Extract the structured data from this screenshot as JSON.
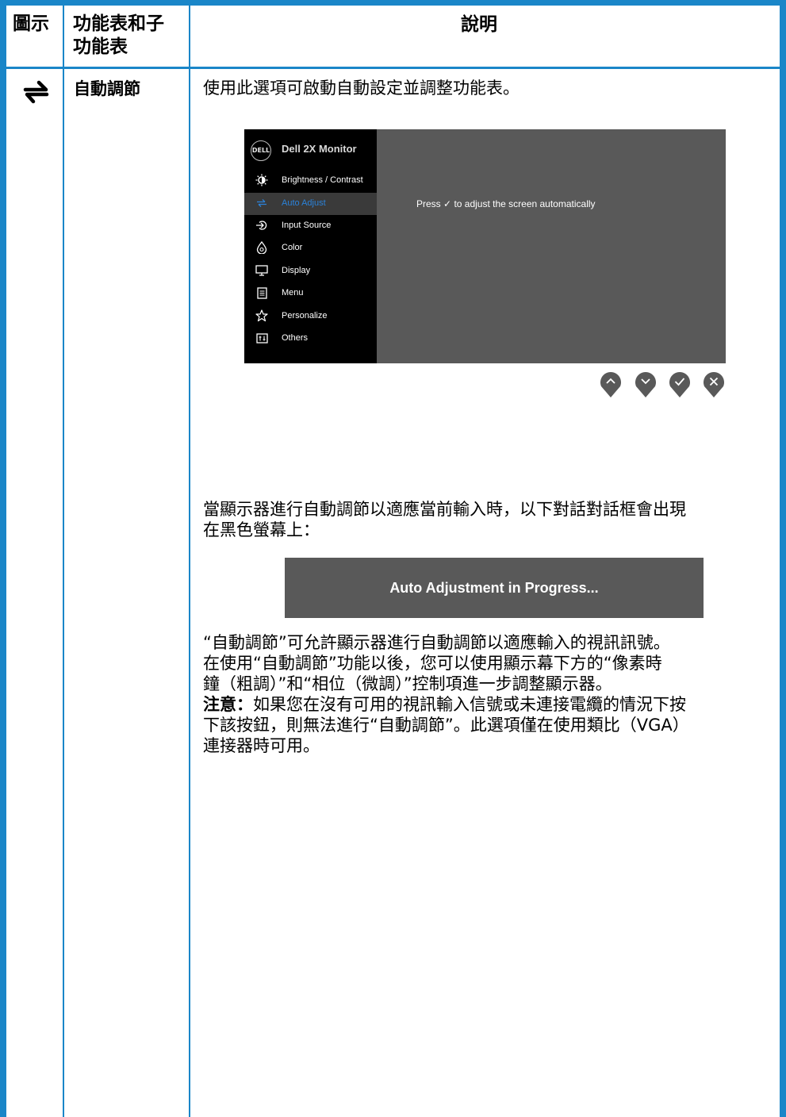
{
  "table": {
    "headers": {
      "icon": "圖示",
      "menu_line1": "功能表和子",
      "menu_line2": "功能表",
      "description": "說明"
    },
    "row": {
      "menu_name": "自動調節",
      "intro": "使用此選項可啟動自動設定並調整功能表。",
      "dialog_intro_line1": "當顯示器進行自動調節以適應當前輸入時，以下對話對話框會出現",
      "dialog_intro_line2": "在黑色螢幕上：",
      "para_line1": "“自動調節”可允許顯示器進行自動調節以適應輸入的視訊訊號。",
      "para_line2": "在使用“自動調節”功能以後，您可以使用顯示幕下方的“像素時",
      "para_line3": "鐘（粗調）”和“相位（微調）”控制項進一步調整顯示器。",
      "note_label": "注意：",
      "note_line1": "如果您在沒有可用的視訊輸入信號或未連接電纜的情況下按",
      "note_line2": "下該按鈕，則無法進行“自動調節”。此選項僅在使用類比（VGA）",
      "note_line3": "連接器時可用。"
    }
  },
  "osd": {
    "logo": "DELL",
    "title": "Dell 2X Monitor",
    "menu_items": [
      {
        "label": "Brightness / Contrast",
        "icon": "brightness-icon"
      },
      {
        "label": "Auto Adjust",
        "icon": "auto-adjust-icon",
        "active": true
      },
      {
        "label": "Input Source",
        "icon": "input-source-icon"
      },
      {
        "label": "Color",
        "icon": "color-icon"
      },
      {
        "label": "Display",
        "icon": "display-icon"
      },
      {
        "label": "Menu",
        "icon": "menu-icon"
      },
      {
        "label": "Personalize",
        "icon": "star-icon"
      },
      {
        "label": "Others",
        "icon": "others-icon"
      }
    ],
    "message_pre": "Press",
    "message_post": "to adjust the screen automatically",
    "buttons": [
      "up-button",
      "down-button",
      "check-button",
      "close-button"
    ]
  },
  "progress_dialog": {
    "text": "Auto Adjustment in Progress..."
  },
  "colors": {
    "table_border": "#1a86c8",
    "osd_panel": "#595959",
    "osd_menu": "#000000",
    "osd_active": "#2b82d9"
  }
}
